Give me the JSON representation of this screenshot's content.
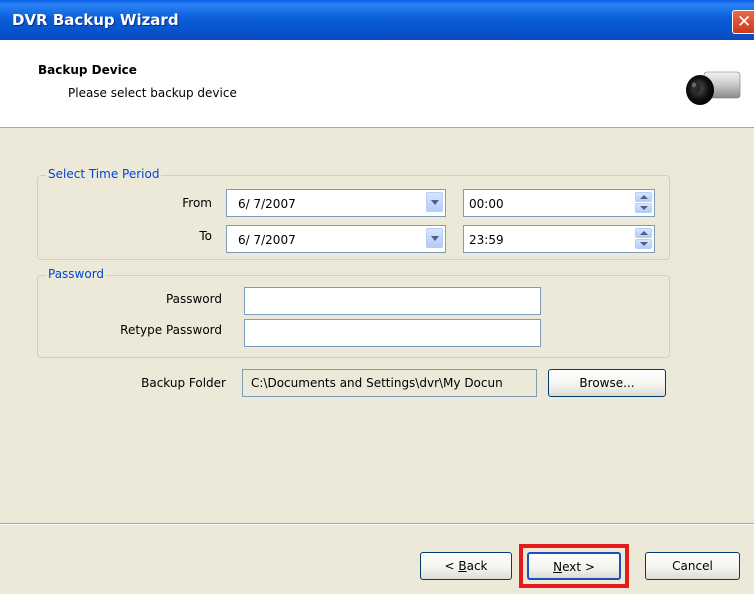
{
  "window": {
    "title": "DVR Backup Wizard"
  },
  "header": {
    "title": "Backup Device",
    "subtitle": "Please select backup device"
  },
  "time_period": {
    "legend": "Select Time Period",
    "from_label": "From",
    "to_label": "To",
    "from_date": "6/ 7/2007",
    "from_time": "00:00",
    "to_date": "6/ 7/2007",
    "to_time": "23:59"
  },
  "password": {
    "legend": "Password",
    "password_label": "Password",
    "retype_label": "Retype Password",
    "password_value": "",
    "retype_value": ""
  },
  "backup_folder": {
    "label": "Backup Folder",
    "value": "C:\\Documents and Settings\\dvr\\My Docun",
    "browse_label": "Browse..."
  },
  "buttons": {
    "back_prefix": "< ",
    "back_mnemonic": "B",
    "back_rest": "ack",
    "next_mnemonic": "N",
    "next_rest": "ext >",
    "cancel": "Cancel"
  },
  "colors": {
    "title_bar": "#0b5ed8",
    "legend_text": "#0046d5",
    "highlight": "#e31b1b"
  },
  "icons": {
    "close": "close-icon",
    "camera": "camera-icon"
  }
}
